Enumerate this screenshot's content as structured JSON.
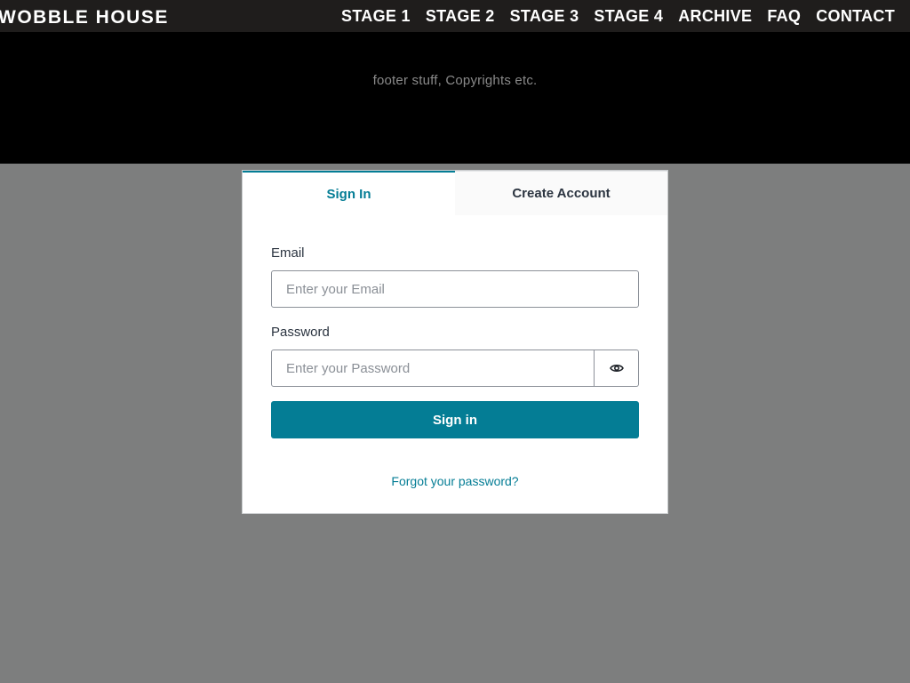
{
  "site": {
    "brand": "WOBBLE HOUSE",
    "nav": [
      "STAGE 1",
      "STAGE 2",
      "STAGE 3",
      "STAGE 4",
      "ARCHIVE",
      "FAQ",
      "CONTACT"
    ],
    "footer_text": "footer stuff, Copyrights etc."
  },
  "auth": {
    "tabs": {
      "sign_in": "Sign In",
      "create_account": "Create Account"
    },
    "active_tab": "sign_in",
    "email": {
      "label": "Email",
      "placeholder": "Enter your Email",
      "value": ""
    },
    "password": {
      "label": "Password",
      "placeholder": "Enter your Password",
      "value": "",
      "toggle_icon": "eye-icon"
    },
    "submit_label": "Sign in",
    "forgot_link": "Forgot your password?"
  },
  "colors": {
    "accent": "#047d95",
    "header_bg": "#1f1d1c",
    "overlay": "#7d7e7e"
  }
}
